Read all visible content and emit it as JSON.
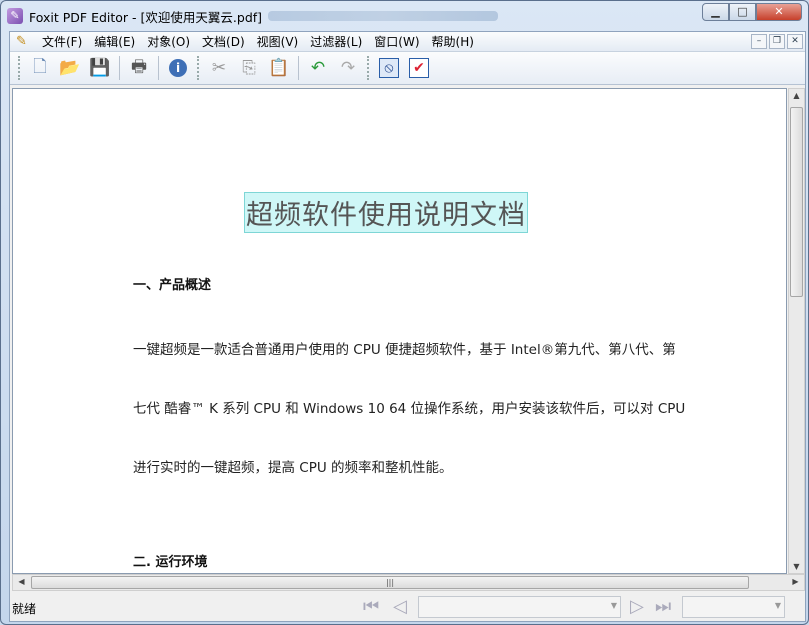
{
  "window": {
    "title": "Foxit PDF Editor - [欢迎使用天翼云.pdf]",
    "minimize": "0",
    "maximize": "□",
    "close": "✕"
  },
  "menu": [
    "文件(F)",
    "编辑(E)",
    "对象(O)",
    "文档(D)",
    "视图(V)",
    "过滤器(L)",
    "窗口(W)",
    "帮助(H)"
  ],
  "mdi": {
    "min": "–",
    "restore": "❐",
    "close": "✕"
  },
  "document": {
    "title": "超频软件使用说明文档",
    "section1": "一、产品概述",
    "lines": [
      "一键超频是一款适合普通用户使用的 CPU 便捷超频软件，基于 Intel®第九代、第八代、第",
      "七代 酷睿™ K 系列 CPU 和 Windows 10 64 位操作系统，用户安装该软件后，可以对 CPU",
      "进行实时的一键超频，提高 CPU 的频率和整机性能。"
    ],
    "section2": "二. 运行环境"
  },
  "status": {
    "text": "就绪",
    "page_value": "",
    "zoom_value": ""
  }
}
